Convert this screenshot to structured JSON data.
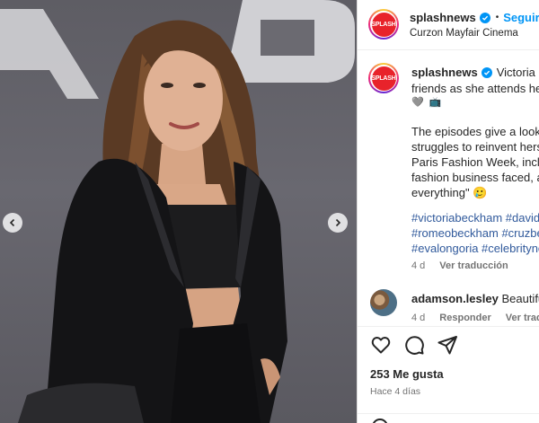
{
  "post": {
    "author": "splashnews",
    "avatar_text": "SPLASH",
    "verified": true,
    "separator": "•",
    "follow_label": "Seguir",
    "location": "Curzon Mayfair Cinema",
    "more_icon": "more-horizontal-icon",
    "image": {
      "background_letters": "AB",
      "description_icon": "photo"
    }
  },
  "caption": {
    "user": "splashnews",
    "line1_rest": "Victoria Bec",
    "line2": "friends as she attends her",
    "emojis": [
      "🩶",
      "📺"
    ],
    "para_lines": [
      "The episodes give a look i",
      "struggles to reinvent herse",
      "Paris Fashion Week, includ",
      "fashion business faced, an",
      "everything\" 🥲"
    ],
    "hashtags": [
      "#victoriabeckham #davidb",
      "#romeobeckham #cruzbe",
      "#evalongoria #celebrityne"
    ],
    "age": "4 d",
    "translate_label": "Ver traducción"
  },
  "comment": {
    "user": "adamson.lesley",
    "text": "Beautiful",
    "age": "4 d",
    "reply_label": "Responder",
    "translate_label": "Ver traducc"
  },
  "actions": {
    "likes": "253 Me gusta",
    "date": "Hace 4 días"
  },
  "colors": {
    "accent_blue": "#0095f6",
    "hashtag_blue": "#315a9c",
    "splash_red": "#e8232b"
  }
}
